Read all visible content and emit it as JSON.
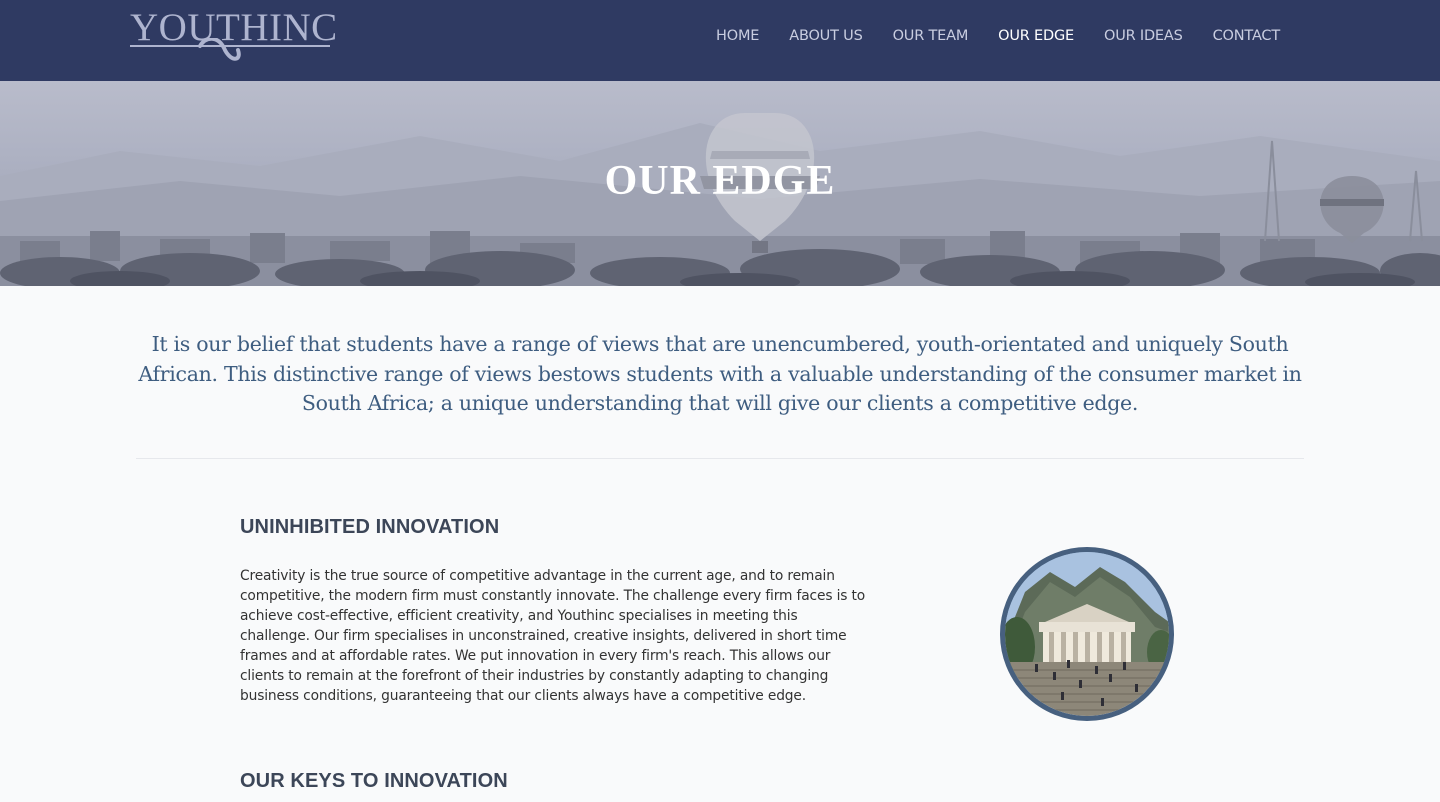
{
  "brand": {
    "logo_text": "YOUTHINC"
  },
  "nav": {
    "items": [
      {
        "label": "HOME"
      },
      {
        "label": "ABOUT US"
      },
      {
        "label": "OUR TEAM"
      },
      {
        "label": "OUR EDGE",
        "active": true
      },
      {
        "label": "OUR IDEAS"
      },
      {
        "label": "CONTACT"
      }
    ]
  },
  "hero": {
    "title": "OUR EDGE"
  },
  "intro": {
    "text": "It is our belief that students have a range of views that are unencumbered, youth-orientated and uniquely South African. This distinctive range of views bestows students with a valuable understanding of the consumer market in South Africa; a unique understanding that will give our clients a competitive edge."
  },
  "sections": [
    {
      "title": "UNINHIBITED INNOVATION",
      "body": "Creativity is the true source of competitive advantage in the current age, and to remain competitive, the modern firm must constantly innovate. The challenge every firm faces is to achieve cost-effective, efficient creativity, and Youthinc specialises in meeting this challenge. Our firm specialises in unconstrained, creative insights, delivered in short time frames and at affordable rates. We put innovation in every firm's reach. This allows our clients to remain at the forefront of their industries by constantly adapting to changing business conditions, guaranteeing that our clients always have a competitive edge.",
      "image": "university-building-photo"
    },
    {
      "title": "OUR KEYS TO INNOVATION"
    }
  ],
  "colors": {
    "header_bg": "#2f3a62",
    "nav_text": "#c9cde0",
    "nav_active": "#ffffff",
    "intro_text": "#3e5d80",
    "heading_text": "#3c4658",
    "photo_border": "#47607f",
    "page_bg": "#f9fafb"
  }
}
